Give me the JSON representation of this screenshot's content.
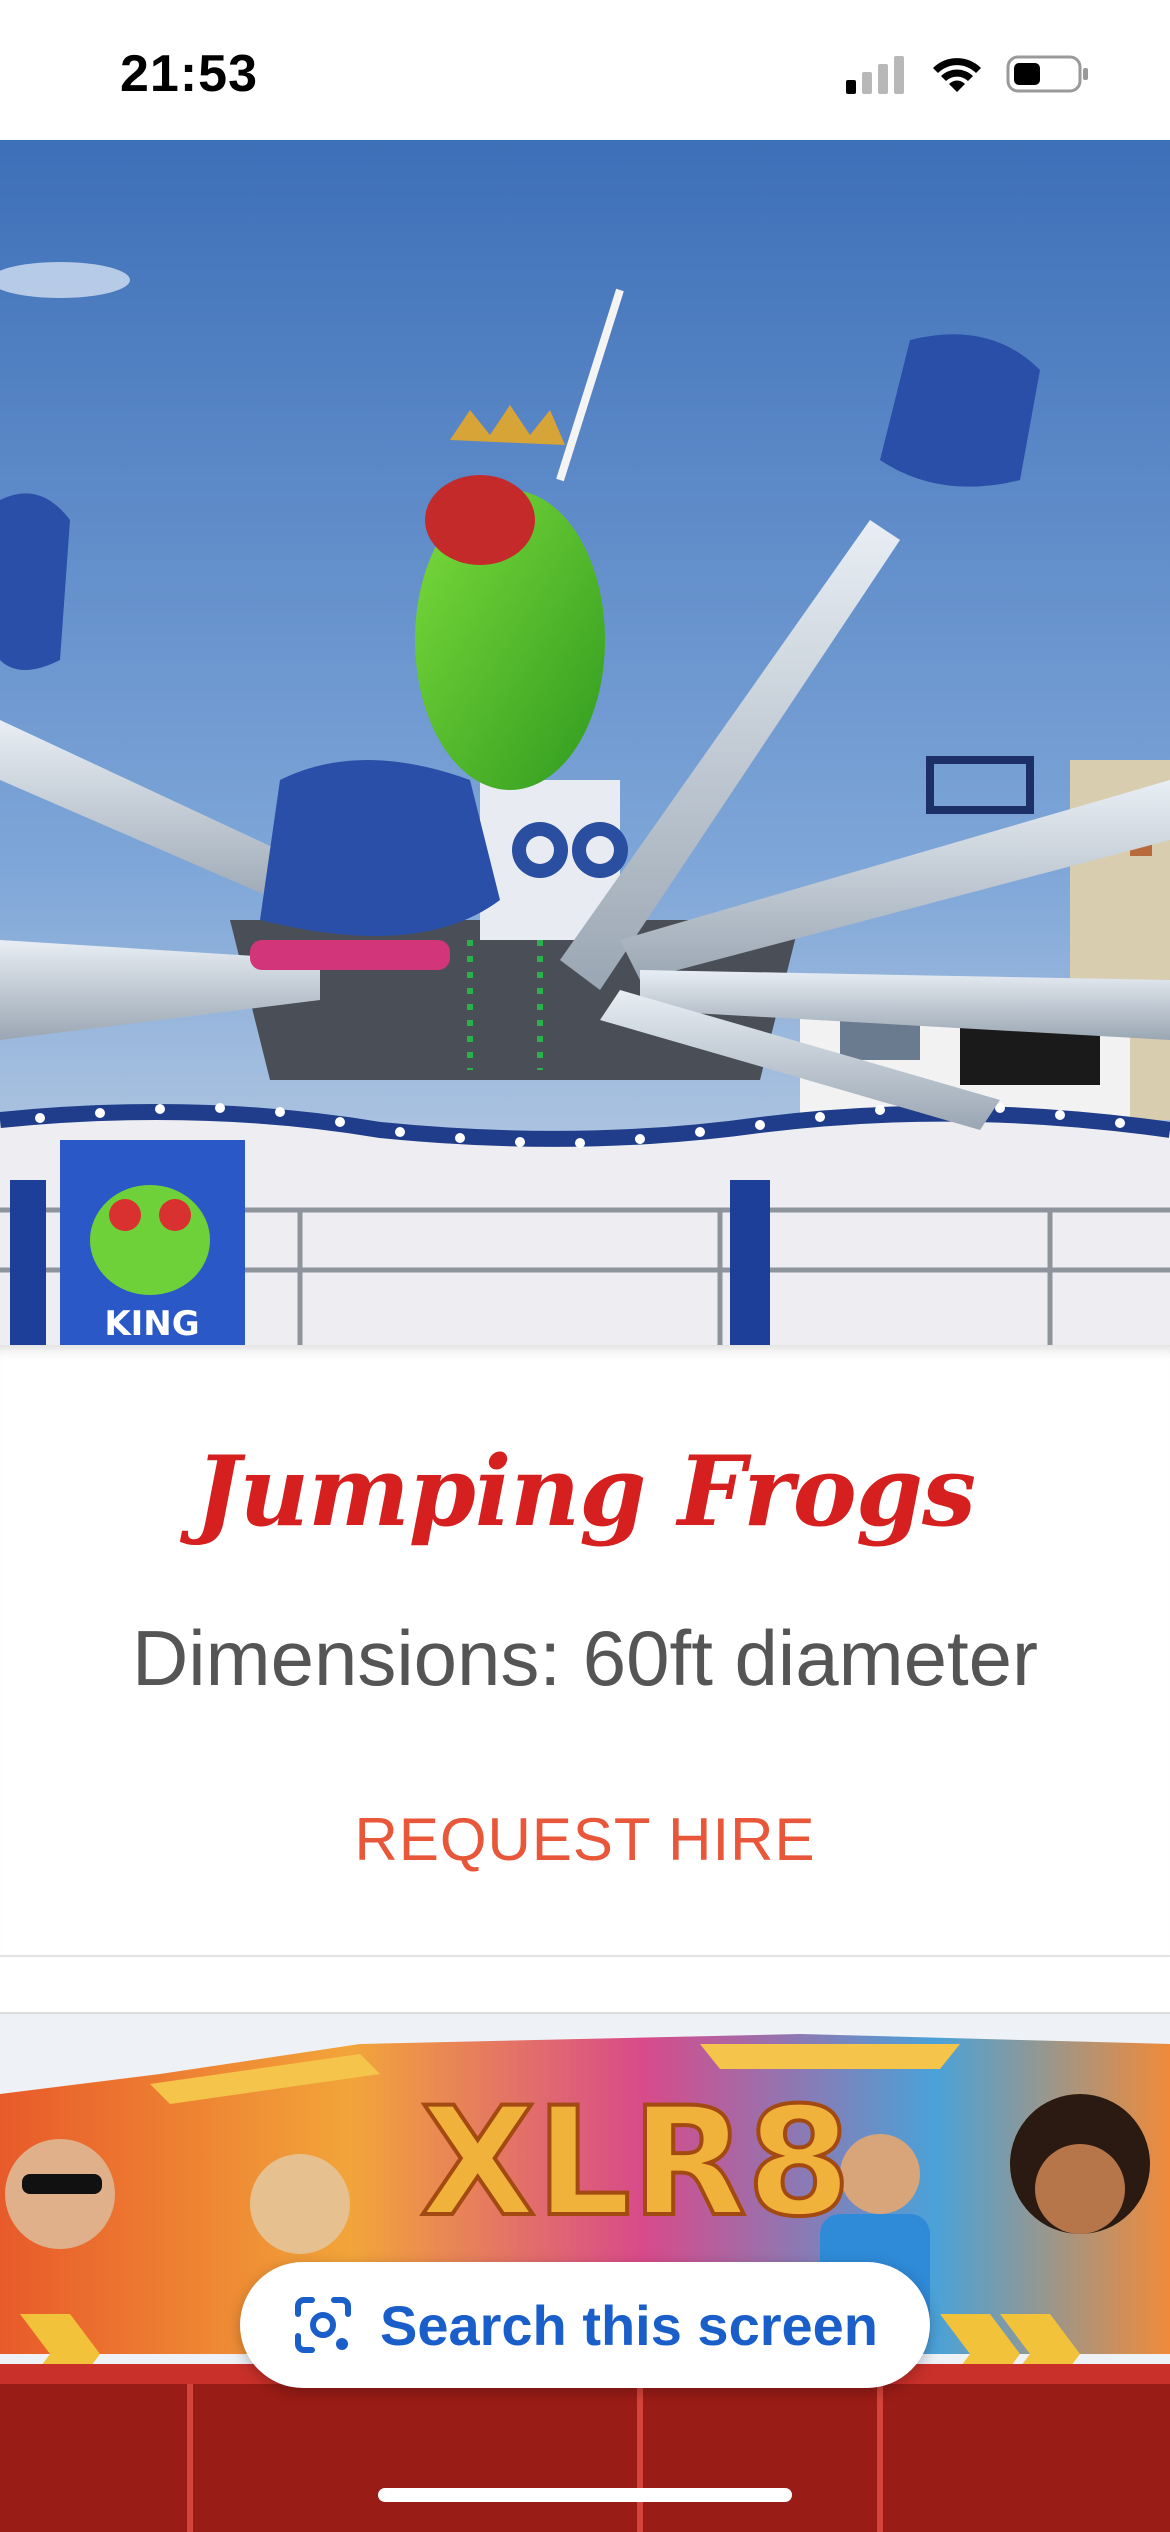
{
  "status_bar": {
    "time": "21:53"
  },
  "ride": {
    "title": "Jumping Frogs",
    "dimensions": "Dimensions: 60ft diameter",
    "request_label": "REQUEST HIRE",
    "sign_text": "KING"
  },
  "next_ride": {
    "sign_text": "XLR8"
  },
  "lens": {
    "label": "Search this screen",
    "icon": "lens-camera-icon"
  },
  "colors": {
    "title": "#d61f1f",
    "request": "#e8573a",
    "dimensions": "#555555",
    "lens_accent": "#1a5fc9"
  }
}
